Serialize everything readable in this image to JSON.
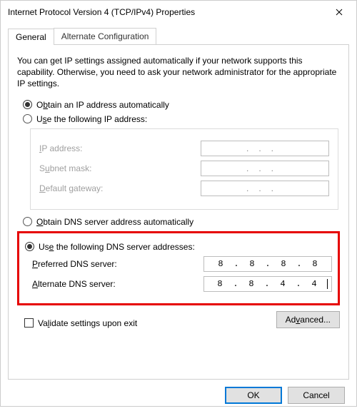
{
  "window": {
    "title": "Internet Protocol Version 4 (TCP/IPv4) Properties"
  },
  "tabs": {
    "general": "General",
    "alternate": "Alternate Configuration",
    "active": "general"
  },
  "intro": "You can get IP settings assigned automatically if your network supports this capability. Otherwise, you need to ask your network administrator for the appropriate IP settings.",
  "ip": {
    "obtain_auto_pre": "O",
    "obtain_auto_acc": "b",
    "obtain_auto_post": "tain an IP address automatically",
    "use_following_pre": "U",
    "use_following_acc": "s",
    "use_following_post": "e the following IP address:",
    "address_pre": "",
    "address_acc": "I",
    "address_post": "P address:",
    "subnet_pre": "S",
    "subnet_acc": "u",
    "subnet_post": "bnet mask:",
    "gateway_pre": "",
    "gateway_acc": "D",
    "gateway_post": "efault gateway:",
    "mode": "auto"
  },
  "dns": {
    "obtain_auto_pre": "",
    "obtain_auto_acc": "O",
    "obtain_auto_post": "btain DNS server address automatically",
    "use_following_pre": "Us",
    "use_following_acc": "e",
    "use_following_post": " the following DNS server addresses:",
    "preferred_pre": "",
    "preferred_acc": "P",
    "preferred_post": "referred DNS server:",
    "alternate_pre": "",
    "alternate_acc": "A",
    "alternate_post": "lternate DNS server:",
    "mode": "manual",
    "preferred_value": {
      "a": "8",
      "b": "8",
      "c": "8",
      "d": "8"
    },
    "alternate_value": {
      "a": "8",
      "b": "8",
      "c": "4",
      "d": "4"
    }
  },
  "validate": {
    "pre": "Va",
    "acc": "l",
    "post": "idate settings upon exit",
    "checked": false
  },
  "advanced": {
    "pre": "Ad",
    "acc": "v",
    "post": "anced..."
  },
  "buttons": {
    "ok": "OK",
    "cancel": "Cancel"
  }
}
